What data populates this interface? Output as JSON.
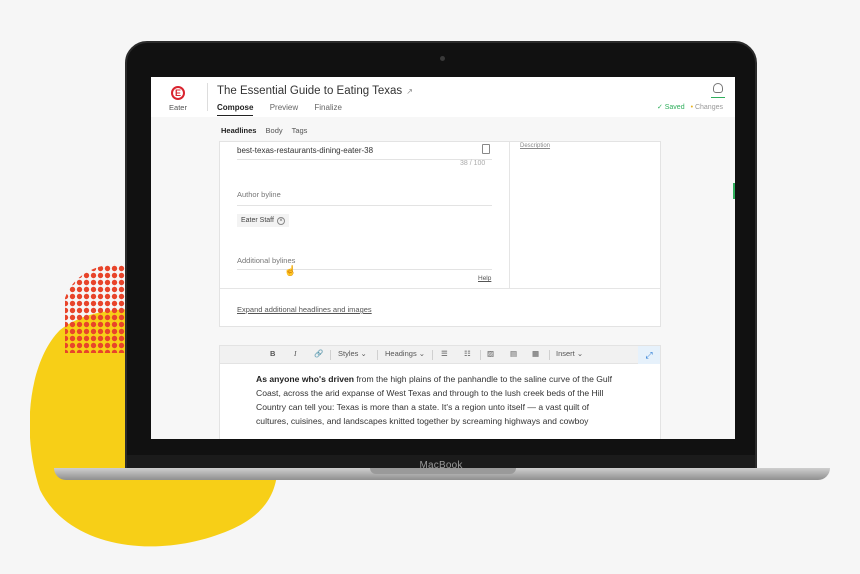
{
  "app": {
    "logo_letter": "E",
    "logo_name": "Eater",
    "document_title": "The Essential Guide to Eating Texas",
    "tabs": [
      "Compose",
      "Preview",
      "Finalize"
    ],
    "status_saved": "✓ Saved",
    "status_changes": "Changes"
  },
  "subtabs": [
    "Headlines",
    "Body",
    "Tags"
  ],
  "form": {
    "slug_value": "best-texas-restaurants-dining-eater-38",
    "slug_counter": "38 / 100",
    "author_label": "Author byline",
    "author_chip": "Eater Staff",
    "additional_label": "Additional bylines",
    "help_link": "Help",
    "expand_link": "Expand additional headlines and images",
    "right_link": "Description"
  },
  "editor": {
    "toolbar": {
      "bold": "B",
      "italic": "I",
      "styles": "Styles ⌄",
      "headings": "Headings ⌄",
      "insert": "Insert ⌄"
    },
    "body_bold": "As anyone who's driven",
    "body_rest": " from the high plains of the panhandle to the saline curve of the Gulf Coast, across the arid expanse of West Texas and through to the lush creek beds of the Hill Country can tell you: Texas is more than a state. It's a region unto itself — a vast quilt of cultures, cuisines, and landscapes knitted together by screaming highways and cowboy"
  },
  "device": {
    "brand": "MacBook"
  },
  "colors": {
    "accent_red": "#d9232e",
    "saved_green": "#2fae5c",
    "blob_yellow": "#f7cf17",
    "dots_red": "#e8442a"
  }
}
